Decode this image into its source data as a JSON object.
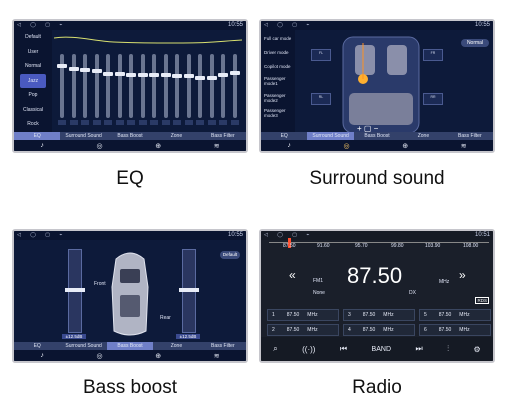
{
  "status_bar": {
    "nav_glyphs": "◁ ◯ ▢ ⌁",
    "time_top": "10:55",
    "time_radio": "10:51"
  },
  "tabs": [
    "EQ",
    "Surround Sound",
    "Bass Boost",
    "Zone",
    "Bass Filter"
  ],
  "captions": {
    "eq": "EQ",
    "surround": "Surround sound",
    "bass": "Bass boost",
    "radio": "Radio"
  },
  "eq": {
    "presets": [
      "Default",
      "User",
      "Normal",
      "Jazz",
      "Pop",
      "Classical",
      "Rock"
    ],
    "selected_preset": "Jazz",
    "band_count": 16,
    "levels": [
      0.85,
      0.8,
      0.78,
      0.76,
      0.72,
      0.72,
      0.7,
      0.7,
      0.7,
      0.7,
      0.68,
      0.68,
      0.66,
      0.66,
      0.7,
      0.74
    ]
  },
  "surround": {
    "modes": [
      "Full car mode",
      "Driver mode",
      "Copilot mode",
      "Passenger mode1",
      "Passenger mode2",
      "Passenger mode3"
    ],
    "dropdown": "Normal"
  },
  "bass": {
    "default_button": "Default",
    "front_label": "Front",
    "rear_label": "Rear",
    "left_level": 0.55,
    "right_level": 0.55,
    "left_freq": "±12.5dB",
    "right_freq": "±12.5dB"
  },
  "radio": {
    "scale": [
      "87.50",
      "91.60",
      "95.70",
      "99.80",
      "103.90",
      "108.00"
    ],
    "frequency": "87.50",
    "band": "FM1",
    "unit": "MHz",
    "mode": "None",
    "dx": "DX",
    "rds": "RDS",
    "presets": [
      {
        "n": "1",
        "f": "87.50",
        "u": "MHz"
      },
      {
        "n": "3",
        "f": "87.50",
        "u": "MHz"
      },
      {
        "n": "5",
        "f": "87.50",
        "u": "MHz"
      },
      {
        "n": "2",
        "f": "87.50",
        "u": "MHz"
      },
      {
        "n": "4",
        "f": "87.50",
        "u": "MHz"
      },
      {
        "n": "6",
        "f": "87.50",
        "u": "MHz"
      }
    ],
    "band_button": "BAND"
  }
}
